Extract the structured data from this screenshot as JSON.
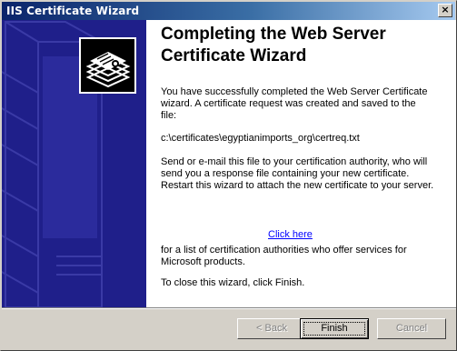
{
  "window": {
    "title": "IIS Certificate Wizard",
    "close_label": "×"
  },
  "heading": {
    "line1": "Completing the Web Server",
    "line2": "Certificate Wizard"
  },
  "body": {
    "p1": "You have successfully completed the Web Server Certificate wizard. A certificate request was created and saved to the file:",
    "file_path": "c:\\certificates\\egyptianimports_org\\certreq.txt",
    "p2": "Send or e-mail this file to your certification authority, who will send you a response file containing your new certificate. Restart this wizard to attach the new certificate to your server.",
    "link_text": "Click here",
    "p3": "for a list of certification authorities who offer services for Microsoft products.",
    "p4": "To close this wizard, click Finish."
  },
  "buttons": {
    "back": "< Back",
    "finish": "Finish",
    "cancel": "Cancel"
  },
  "colors": {
    "title_gradient_start": "#0a246a",
    "left_panel": "#1f1f8a",
    "link": "#0000ff",
    "dialog_face": "#d4d0c8"
  },
  "icons": {
    "wizard_logo": "certificate-stack-icon",
    "panel_art": "server-outline-art"
  }
}
